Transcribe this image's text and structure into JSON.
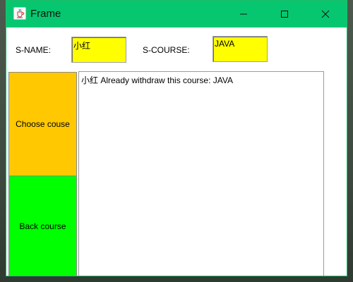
{
  "window": {
    "title": "Frame",
    "titlebar_color": "#06c770",
    "controls": {
      "minimize": "minimize-icon",
      "maximize": "maximize-icon",
      "close": "close-icon"
    }
  },
  "form": {
    "name_label": "S-NAME:",
    "name_value": "小红",
    "course_label": "S-COURSE:",
    "course_value": "JAVA",
    "field_color": "#ffff00"
  },
  "actions": {
    "choose_label": "Choose couse",
    "choose_color": "#ffc800",
    "back_label": "Back course",
    "back_color": "#00ff00"
  },
  "output": {
    "text": "小红 Already withdraw this course: JAVA"
  }
}
